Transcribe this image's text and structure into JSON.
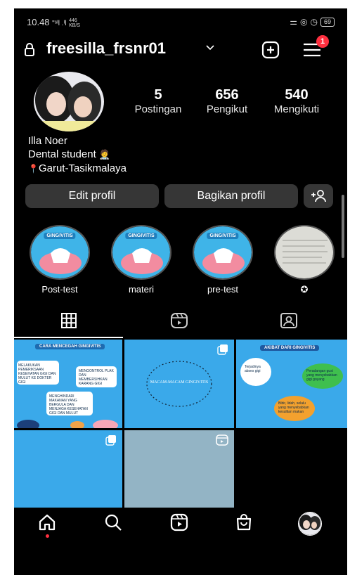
{
  "status": {
    "time": "10.48",
    "signal_text": "\"ˢᴵl .ᴵl",
    "speed_value": "446",
    "speed_unit": "KB/S",
    "battery": "69"
  },
  "header": {
    "username": "freesilla_frsnr01",
    "notification_count": "1"
  },
  "stats": [
    {
      "value": "5",
      "label": "Postingan"
    },
    {
      "value": "656",
      "label": "Pengikut"
    },
    {
      "value": "540",
      "label": "Mengikuti"
    }
  ],
  "bio": {
    "name": "Illa Noer",
    "line1": "Dental student",
    "line1_emoji": "🧑‍⚕️",
    "pin": "📍",
    "line2": "Garut-Tasikmalaya"
  },
  "buttons": {
    "edit": "Edit profil",
    "share": "Bagikan profil"
  },
  "highlights": [
    {
      "label": "Post-test",
      "tag": "GINGIVITIS"
    },
    {
      "label": "materi",
      "tag": "GINGIVITIS"
    },
    {
      "label": "pre-test",
      "tag": "GINGIVITIS"
    },
    {
      "label": "✪",
      "tag": ""
    }
  ],
  "posts": {
    "p1_title": "CARA MENCEGAH GINGIVITIS",
    "p1_items": [
      "MELAKUKAN PEMERIKSAAN KESEHATAN GIGI DAN MULUT KE DOKTER GIGI",
      "MENGONTROL PLAK DAN MEMBERSIHKAN KARANG GIGI",
      "MENGHINDARI MAKANAN YANG BERGULA DAN MENJAGA KESEHATAN GIGI DAN MULUT"
    ],
    "p2_title": "MACAM-MACAM GINGIVITIS",
    "p3_title": "AKIBAT DARI GINGIVITIS",
    "p3_items": [
      "Terjadinya abses gigi",
      "Peradangan gusi yang menyebabkan gigi goyang",
      "Bibir, lidah, selalu yang menyebabkan kesulitan makan"
    ]
  },
  "colors": {
    "background": "#000000",
    "button": "#363636",
    "badge": "#ff3040",
    "post_blue": "#3aa9ea"
  }
}
